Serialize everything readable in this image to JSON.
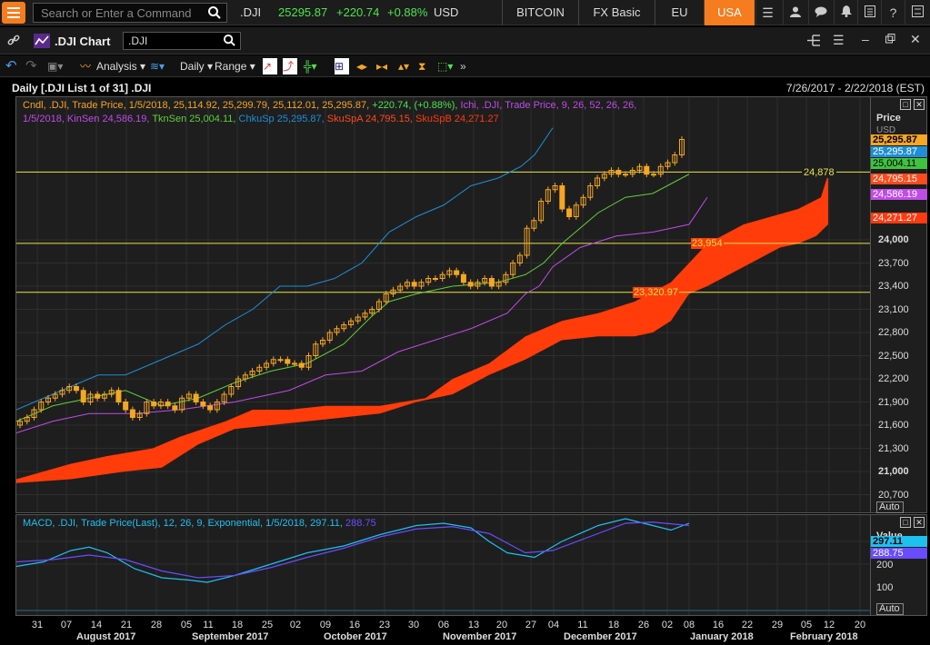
{
  "topbar": {
    "search_placeholder": "Search or Enter a Command",
    "symbol": ".DJI",
    "last": "25295.87",
    "change": "+220.74",
    "pct": "+0.88%",
    "currency": "USD",
    "tabs": [
      "BITCOIN",
      "FX Basic",
      "EU",
      "USA"
    ]
  },
  "chart_window": {
    "title": ".DJI Chart",
    "symbol_input": ".DJI"
  },
  "toolbar": {
    "analysis": "Analysis",
    "interval": "Daily",
    "range": "Range"
  },
  "info": {
    "left": "Daily [.DJI List 1 of 31] .DJI",
    "right": "7/26/2017 - 2/22/2018 (EST)"
  },
  "legend": {
    "line1_a": "Cndl, .DJI, Trade Price, 1/5/2018, 25,114.92, 25,299.79, 25,112.01, 25,295.87,",
    "line1_b": "+220.74, (+0.88%),",
    "line1_c": "Ichi, .DJI, Trade Price, 9, 26, 52, 26, 26,",
    "line2_a": "1/5/2018, KinSen 24,586.19,",
    "line2_b": "TknSen 25,004.11,",
    "line2_c": "ChkuSp 25,295.87,",
    "line2_d": "SkuSpA 24,795.15,",
    "line2_e": "SkuSpB 24,271.27"
  },
  "price_axis": {
    "title": "Price",
    "unit": "USD",
    "ticks": [
      "24,000",
      "23,700",
      "23,400",
      "23,100",
      "22,800",
      "22,500",
      "22,200",
      "21,900",
      "21,600",
      "21,300",
      "21,000",
      "20,700"
    ],
    "auto": "Auto",
    "labels": [
      {
        "text": "25,295.87",
        "bg": "#f5a623",
        "fg": "#000"
      },
      {
        "text": "25,295.87",
        "bg": "#1e8fd6",
        "fg": "#fff"
      },
      {
        "text": "25,004.11",
        "bg": "#3fc23f",
        "fg": "#000"
      },
      {
        "text": "24,795.15",
        "bg": "#ff4a1c",
        "fg": "#fff"
      },
      {
        "text": "24,586.19",
        "bg": "#c04ce8",
        "fg": "#fff"
      },
      {
        "text": "24,271.27",
        "bg": "#ff3a10",
        "fg": "#fff"
      }
    ]
  },
  "hlines": [
    "24,878",
    "23,954",
    "23,320.97"
  ],
  "macd": {
    "legend_a": "MACD, .DJI, Trade Price(Last), 12, 26, 9, Exponential, 1/5/2018, 297.11,",
    "legend_b": "288.75",
    "axis_title": "Value",
    "ticks": [
      "200",
      "100"
    ],
    "auto": "Auto",
    "labels": [
      {
        "text": "297.11",
        "bg": "#1ec0f0",
        "fg": "#000"
      },
      {
        "text": "288.75",
        "bg": "#6a4cff",
        "fg": "#fff"
      }
    ]
  },
  "xaxis": {
    "days": [
      "31",
      "07",
      "14",
      "21",
      "28",
      "05",
      "11",
      "18",
      "25",
      "02",
      "09",
      "16",
      "23",
      "30",
      "06",
      "13",
      "20",
      "27",
      "04",
      "11",
      "18",
      "26",
      "02",
      "08",
      "16",
      "22",
      "29",
      "05",
      "12",
      "20"
    ],
    "months": [
      "August 2017",
      "September 2017",
      "October 2017",
      "November 2017",
      "December 2017",
      "January 2018",
      "February 2018"
    ]
  },
  "colors": {
    "accent": "#f57c1f",
    "cloud": "#ff3c0a",
    "kijun": "#c04ce8",
    "tenkan": "#5ecf3a",
    "chikou": "#1e8fd6",
    "candle": "#f5a623",
    "hline": "#e8e34a",
    "macd": "#1ec0f0",
    "signal": "#6a4cff"
  }
}
